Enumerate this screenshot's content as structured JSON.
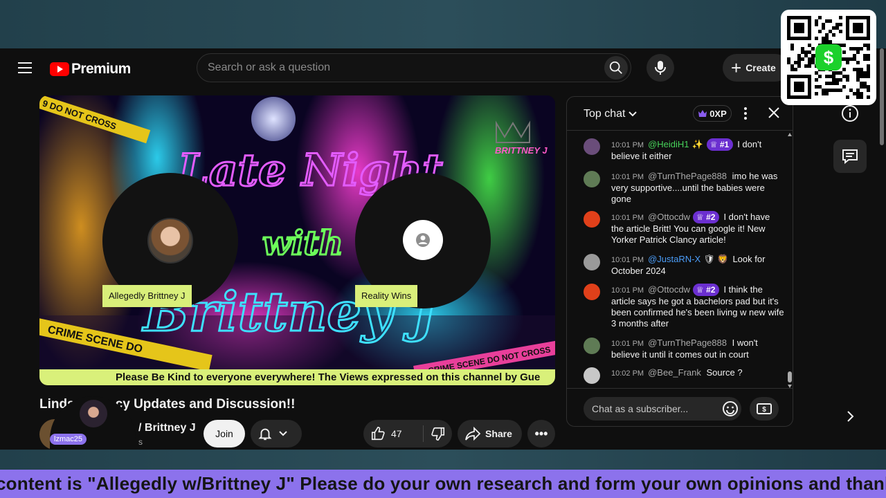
{
  "app": {
    "brand": "Premium"
  },
  "search": {
    "placeholder": "Search or ask a question"
  },
  "header": {
    "create_label": "Create"
  },
  "video": {
    "participants": [
      {
        "name": "Allegedly Brittney J"
      },
      {
        "name": "Reality Wins"
      }
    ],
    "banner_text": "Please Be Kind to everyone everywhere! The Views expressed on this channel by Gue",
    "art_texts": {
      "main_1": "Late Night",
      "main_2": "with",
      "main_3": "Brittney J",
      "brand_tag": "BRITTNEY J",
      "tape_1": "9 DO NOT CROSS",
      "tape_2": "CRIME SCENE DO",
      "tape_3": "CRIME SCENE DO NOT CROSS"
    }
  },
  "meta": {
    "title": "Linds",
    "title_rest": "cy Updates and Discussion!!",
    "channel_name": "/ Brittney J",
    "channel_subs": "s",
    "join_label": "Join",
    "likes": "47",
    "share_label": "Share"
  },
  "pip": {
    "username": "lzmac25"
  },
  "chat": {
    "mode": "Top chat",
    "xp": "0XP",
    "messages": [
      {
        "time": "10:01 PM",
        "author": "@HeidiH1",
        "badge": "✨",
        "rank": "#1",
        "text": "I don't believe it either",
        "color": "green",
        "avatar": "#6a4d7a"
      },
      {
        "time": "10:01 PM",
        "author": "@TurnThePage888",
        "badge": "",
        "rank": "",
        "text": "imo he was very supportive....until the babies were gone",
        "color": "default",
        "avatar": "#5f7b55"
      },
      {
        "time": "10:01 PM",
        "author": "@Ottocdw",
        "badge": "",
        "rank": "#2",
        "text": "I don't have the article Britt! You can google it! New Yorker Patrick Clancy article!",
        "color": "default",
        "avatar": "#e0401a"
      },
      {
        "time": "10:01 PM",
        "author": "@JustaRN-X",
        "badge": "🛡 🦁",
        "rank": "",
        "text": "Look for October 2024",
        "color": "blue",
        "avatar": "#9a9a9a"
      },
      {
        "time": "10:01 PM",
        "author": "@Ottocdw",
        "badge": "",
        "rank": "#2",
        "text": "I think the article says he got a bachelors pad but it's been confirmed he's been living w new wife 3 months after",
        "color": "default",
        "avatar": "#e0401a"
      },
      {
        "time": "10:01 PM",
        "author": "@TurnThePage888",
        "badge": "",
        "rank": "",
        "text": "I won't believe it until it comes out in court",
        "color": "default",
        "avatar": "#5f7b55"
      },
      {
        "time": "10:02 PM",
        "author": "@Bee_Frank",
        "badge": "",
        "rank": "",
        "text": "Source ?",
        "color": "default",
        "avatar": "#c7c7c7"
      }
    ],
    "input_placeholder": "Chat as a subscriber..."
  },
  "ticker": {
    "text": "content is \"Allegedly w/Brittney J\" Please do your own research and form your own opinions and thank you f"
  },
  "colors": {
    "accent_lime": "#d9ef7a",
    "ticker_purple": "#8c72ec",
    "youtube_red": "#ff0000",
    "rank_purple": "#6b2fd0"
  },
  "icons": [
    "hamburger-icon",
    "youtube-logo-icon",
    "search-icon",
    "mic-icon",
    "plus-icon",
    "qr-code",
    "cash-app-icon",
    "chevron-down-icon",
    "crown-icon",
    "more-vert-icon",
    "close-icon",
    "emoji-icon",
    "superchat-icon",
    "info-icon",
    "chat-icon",
    "chevron-right-icon",
    "bell-icon",
    "thumb-up-icon",
    "thumb-down-icon",
    "share-icon",
    "more-horiz-icon"
  ]
}
